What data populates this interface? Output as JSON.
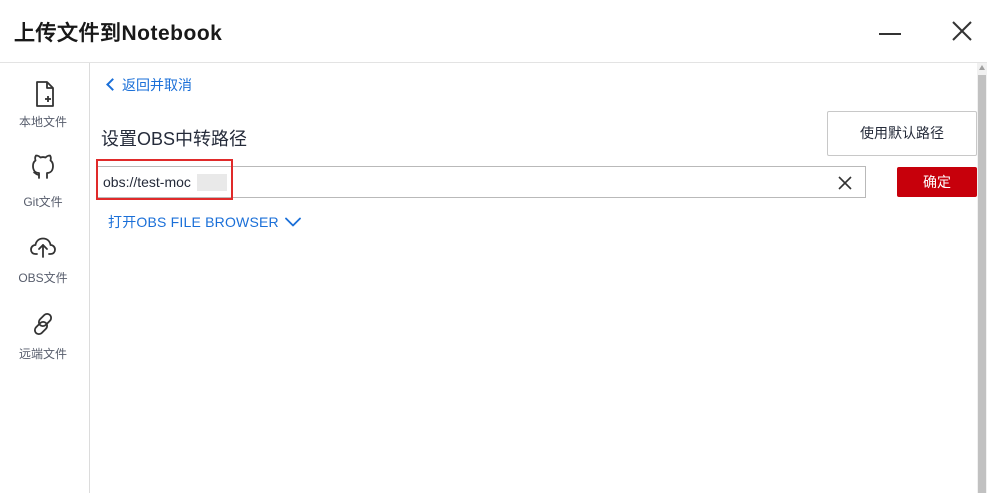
{
  "dialog": {
    "title": "上传文件到Notebook"
  },
  "sidebar": {
    "items": [
      {
        "label": "本地文件",
        "icon": "file-add-icon"
      },
      {
        "label": "Git文件",
        "icon": "github-icon"
      },
      {
        "label": "OBS文件",
        "icon": "cloud-upload-icon"
      },
      {
        "label": "远端文件",
        "icon": "link-icon"
      }
    ]
  },
  "main": {
    "back_label": "返回并取消",
    "section_title": "设置OBS中转路径",
    "default_path_button": "使用默认路径",
    "path_input_value": "obs://test-moc",
    "confirm_button": "确定",
    "obs_browser_link": "打开OBS FILE BROWSER"
  },
  "colors": {
    "accent_link": "#1a6fd8",
    "confirm_red": "#c7000b",
    "highlight_red": "#e02a2a"
  }
}
